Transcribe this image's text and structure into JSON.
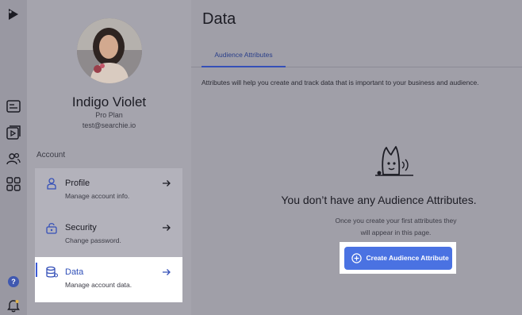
{
  "sidebar_rail": {
    "icons": [
      "logo-icon",
      "playlist-icon",
      "video-icon",
      "audience-icon",
      "apps-grid-icon",
      "help-icon",
      "notifications-icon"
    ],
    "help_label": "?"
  },
  "account_panel": {
    "user": {
      "name": "Indigo Violet",
      "plan": "Pro Plan",
      "email": "test@searchie.io"
    },
    "section_label": "Account",
    "menu": [
      {
        "title": "Profile",
        "subtitle": "Manage account info.",
        "icon": "person-icon",
        "active": false
      },
      {
        "title": "Security",
        "subtitle": "Change password.",
        "icon": "lock-icon",
        "active": false
      },
      {
        "title": "Data",
        "subtitle": "Manage account data.",
        "icon": "database-icon",
        "active": true
      }
    ]
  },
  "main": {
    "title": "Data",
    "tabs": [
      {
        "label": "Audience Attributes",
        "active": true
      }
    ],
    "description": "Attributes will help you create and track data that is important to your business and audience.",
    "empty_state": {
      "title": "You don’t have any Audience Attributes.",
      "subtitle_line1": "Once you create your first attributes they",
      "subtitle_line2": "will appear in this page.",
      "button_label": "Create Audience Attribute"
    }
  },
  "colors": {
    "accent": "#4a72e2",
    "active_text": "#2f4fb8",
    "overlay_bg": "#a09fa8"
  }
}
